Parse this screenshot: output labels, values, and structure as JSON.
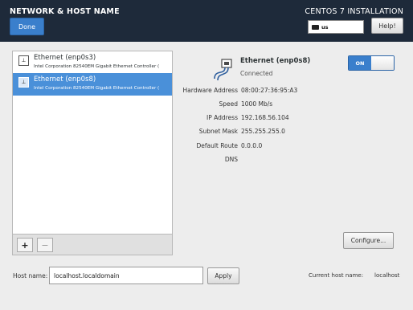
{
  "header": {
    "title": "NETWORK & HOST NAME",
    "product": "CENTOS 7 INSTALLATION",
    "done_label": "Done",
    "keyboard_layout": "us",
    "help_label": "Help!"
  },
  "devices": [
    {
      "name": "Ethernet (enp0s3)",
      "description": "Intel Corporation 82540EM Gigabit Ethernet Controller (",
      "selected": false
    },
    {
      "name": "Ethernet (enp0s8)",
      "description": "Intel Corporation 82540EM Gigabit Ethernet Controller (",
      "selected": true
    }
  ],
  "list_controls": {
    "add_label": "+",
    "remove_label": "−"
  },
  "detail": {
    "name": "Ethernet (enp0s8)",
    "status": "Connected",
    "toggle_label": "ON",
    "toggle_state": "on",
    "properties": [
      {
        "label": "Hardware Address",
        "value": "08:00:27:36:95:A3"
      },
      {
        "label": "Speed",
        "value": "1000 Mb/s"
      },
      {
        "label": "IP Address",
        "value": "192.168.56.104"
      },
      {
        "label": "Subnet Mask",
        "value": "255.255.255.0"
      },
      {
        "label": "Default Route",
        "value": "0.0.0.0"
      },
      {
        "label": "DNS",
        "value": ""
      }
    ],
    "configure_label": "Configure..."
  },
  "hostname": {
    "label": "Host name:",
    "value": "localhost.localdomain",
    "apply_label": "Apply",
    "current_label": "Current host name:",
    "current_value": "localhost"
  },
  "colors": {
    "header_bg": "#1e2a3a",
    "accent": "#3a7fcc",
    "selection": "#4a90d9"
  },
  "icons": {
    "device": "network-wired-icon",
    "keyboard": "keyboard-icon"
  }
}
